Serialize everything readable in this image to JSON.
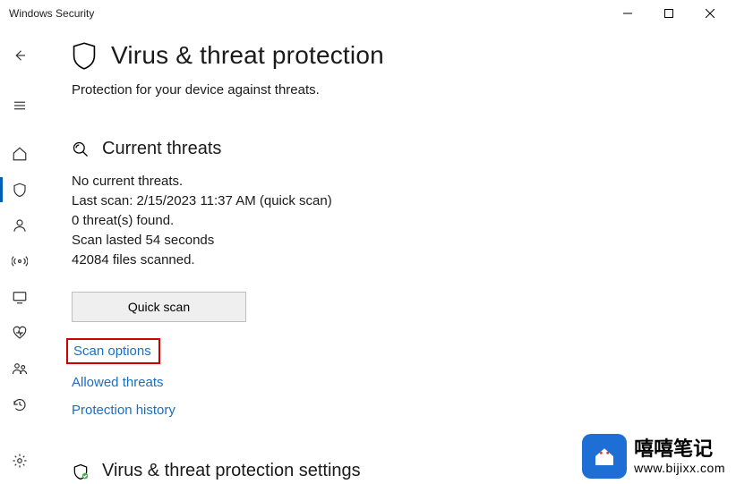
{
  "window": {
    "title": "Windows Security"
  },
  "nav": {
    "back": "back-icon",
    "menu": "hamburger-icon",
    "items": [
      {
        "name": "nav-home",
        "icon": "home-icon",
        "active": false
      },
      {
        "name": "nav-virus",
        "icon": "shield-icon",
        "active": true
      },
      {
        "name": "nav-account",
        "icon": "person-icon",
        "active": false
      },
      {
        "name": "nav-firewall",
        "icon": "signal-icon",
        "active": false
      },
      {
        "name": "nav-app-browser",
        "icon": "monitor-icon",
        "active": false
      },
      {
        "name": "nav-device-perf",
        "icon": "health-icon",
        "active": false
      },
      {
        "name": "nav-family",
        "icon": "group-icon",
        "active": false
      },
      {
        "name": "nav-history",
        "icon": "history-icon",
        "active": false
      }
    ],
    "settings": "settings-icon"
  },
  "page": {
    "title": "Virus & threat protection",
    "subtitle": "Protection for your device against threats."
  },
  "current_threats": {
    "heading": "Current threats",
    "lines": {
      "none": "No current threats.",
      "last_scan": "Last scan: 2/15/2023 11:37 AM (quick scan)",
      "found": "0 threat(s) found.",
      "duration": "Scan lasted 54 seconds",
      "files": "42084 files scanned."
    },
    "quick_scan_button": "Quick scan",
    "links": {
      "scan_options": "Scan options",
      "allowed_threats": "Allowed threats",
      "protection_history": "Protection history"
    }
  },
  "settings_section": {
    "heading": "Virus & threat protection settings"
  },
  "watermark": {
    "cn": "嘻嘻笔记",
    "url": "www.bijixx.com"
  }
}
